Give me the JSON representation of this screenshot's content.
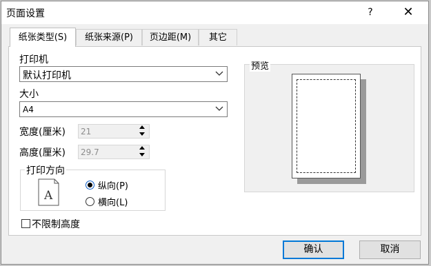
{
  "window": {
    "title": "页面设置",
    "help_label": "?",
    "close_label": "✕"
  },
  "tabs": [
    {
      "label": "纸张类型(S)"
    },
    {
      "label": "纸张来源(P)"
    },
    {
      "label": "页边距(M)"
    },
    {
      "label": "其它"
    }
  ],
  "printer": {
    "label": "打印机",
    "value": "默认打印机"
  },
  "size": {
    "label": "大小",
    "value": "A4"
  },
  "width": {
    "label": "宽度(厘米)",
    "value": "21"
  },
  "height": {
    "label": "高度(厘米)",
    "value": "29.7"
  },
  "orientation": {
    "label": "打印方向",
    "icon_letter": "A",
    "portrait_label": "纵向(P)",
    "landscape_label": "横向(L)"
  },
  "unlimited_height_label": "不限制高度",
  "preview": {
    "label": "预览"
  },
  "buttons": {
    "ok": "确认",
    "cancel": "取消"
  }
}
